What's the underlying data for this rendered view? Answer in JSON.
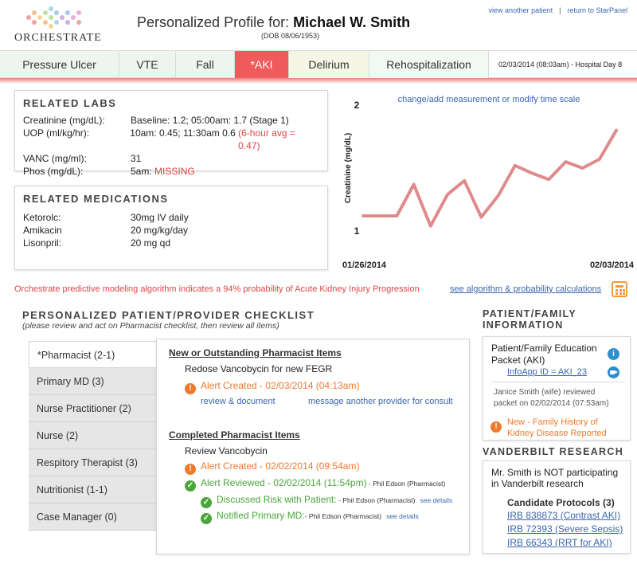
{
  "header": {
    "logo_text": "ORCHESTRATE",
    "title_prefix": "Personalized Profile for:",
    "patient_name": "Michael W. Smith",
    "dob": "(DOB 08/06/1953)",
    "link_view_another": "view another patient",
    "link_separator": "|",
    "link_return": "return to StarPanel"
  },
  "tabs": [
    "Pressure Ulcer",
    "VTE",
    "Fall",
    "*AKI",
    "Delirium",
    "Rehospitalization"
  ],
  "tab_info": "02/03/2014 (08:03am) - Hospital Day 8",
  "colors": {
    "accent": "#ef5b5b",
    "link": "#3a66b0",
    "warning": "#ee7a2c",
    "ok": "#4aa63b",
    "info": "#2e8fd0"
  },
  "labs": {
    "heading": "RELATED LABS",
    "rows": [
      {
        "label": "Creatinine (mg/dL):",
        "value": "Baseline: 1.2;  05:00am: 1.7 (Stage 1)",
        "flag": ""
      },
      {
        "label": "UOP (ml/kg/hr):",
        "value": "10am: 0.45; 11:30am 0.6 ",
        "flag": "(6-hour avg = 0.47)"
      },
      {
        "label": "VANC (mg/ml):",
        "value": "31",
        "flag": ""
      },
      {
        "label": "Phos (mg/dL):",
        "value": "5am: ",
        "flag": "MISSING"
      }
    ]
  },
  "meds": {
    "heading": "RELATED MEDICATIONS",
    "rows": [
      {
        "name": "Ketorolc:",
        "dose": "30mg IV daily"
      },
      {
        "name": "Amikacin",
        "dose": "20 mg/kg/day"
      },
      {
        "name": "Lisonpril:",
        "dose": "20 mg qd"
      }
    ]
  },
  "chart_link": "change/add measurement or modify time scale",
  "chart_data": {
    "type": "line",
    "title": "",
    "xlabel": "",
    "ylabel": "Creatinine (mg/dL)",
    "x_tick_labels": [
      "01/26/2014",
      "02/03/2014"
    ],
    "y_tick_labels": [
      "1",
      "2"
    ],
    "ylim": [
      1,
      2
    ],
    "xlim": [
      0,
      15
    ],
    "grid": false,
    "color": "#e08b8b",
    "series": [
      {
        "x": [
          0,
          1,
          2,
          3,
          4,
          5,
          6,
          7,
          8,
          9,
          10,
          11,
          12,
          13,
          14,
          15
        ],
        "y": [
          1.12,
          1.12,
          1.12,
          1.37,
          1.04,
          1.29,
          1.4,
          1.11,
          1.28,
          1.52,
          1.46,
          1.41,
          1.55,
          1.5,
          1.57,
          1.8
        ]
      }
    ]
  },
  "prediction": {
    "text": "Orchestrate predictive modeling algorithm indicates a 94% probability of Acute Kidney Injury Progression",
    "link": "see algorithm & probability calculations",
    "icon": "calculator-icon"
  },
  "checklist": {
    "heading": "PERSONALIZED PATIENT/PROVIDER CHECKLIST",
    "subheading": "(please review and act on Pharmacist checklist, then review all items)",
    "roles": [
      "*Pharmacist (2-1)",
      "Primary MD (3)",
      "Nurse Practitioner (2)",
      "Nurse (2)",
      "Respitory Therapist (3)",
      "Nutritionist (1-1)",
      "Case Manager (0)"
    ],
    "outstanding_heading": "New or Outstanding Pharmacist Items",
    "outstanding_item": "Redose Vancobycin for new FEGR",
    "outstanding_alert": "Alert Created - 02/03/2014 (04:13am)",
    "action_review": "review & document",
    "action_message": "message another provider for consult",
    "completed_heading": "Completed Pharmacist Items",
    "completed_item": "Review Vancobycin",
    "completed_alert": "Alert Created - 02/02/2014 (09:54am)",
    "completed_reviewed": "Alert Reviewed - 02/02/2014 (11:54pm)",
    "completed_reviewed_by": " - Phil Edson (Pharmacist)",
    "discussed": "Discussed Risk with Patient:",
    "discussed_by": " - Phil Edson (Pharmacist)",
    "notified": "Notified Primary MD:",
    "notified_by": "- Phil Edson (Pharmacist)",
    "see_details": "see details"
  },
  "family": {
    "heading1": "PATIENT/FAMILY",
    "heading2": "INFORMATION",
    "edu_title1": "Patient/Family Education",
    "edu_title2": "Packet (AKI)",
    "infoapp": "InfoApp ID = AKI_23",
    "note1": "Janice Smith (wife) reviewed",
    "note2": "packet on 02/02/2014 (07:53am)",
    "alert1": "New - Family History of",
    "alert2": "Kidney Disease Reported"
  },
  "research": {
    "heading": "VANDERBILT RESEARCH",
    "line1": "Mr. Smith is NOT participating",
    "line2": "in Vanderbilt research",
    "protocols_heading": "Candidate Protocols (3)",
    "protocols": [
      "IRB 838873 (Contrast AKI)",
      "IRB 72393 (Severe Sepsis)",
      "IRB 66343 (RRT for AKI)"
    ]
  }
}
